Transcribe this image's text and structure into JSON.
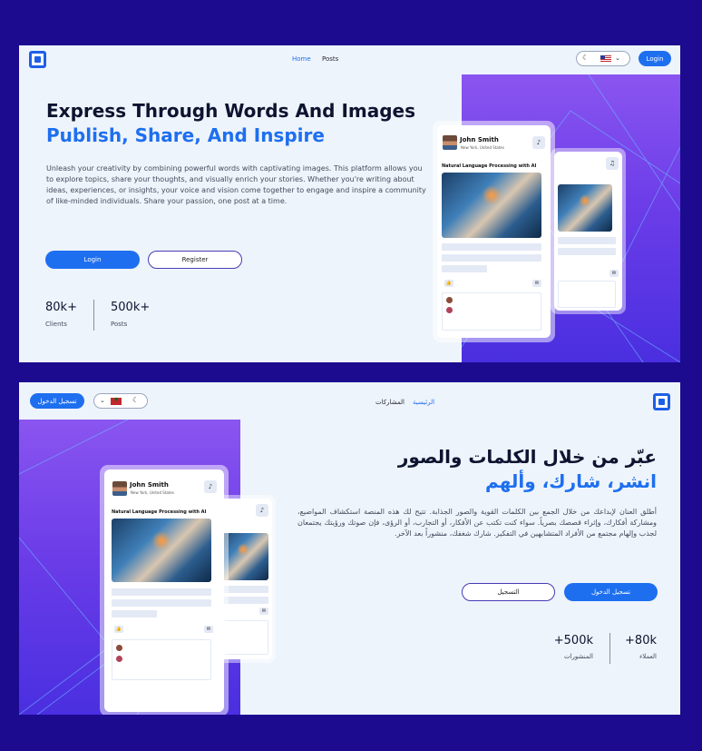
{
  "english": {
    "nav": {
      "home": "Home",
      "posts": "Posts"
    },
    "login_button": "Login",
    "headline": "Express Through Words And Images",
    "subheadline": "Publish, Share, And Inspire",
    "description": "Unleash your creativity by combining powerful words with captivating images. This platform allows you to explore topics, share your thoughts, and visually enrich your stories. Whether you're writing about ideas, experiences, or insights, your voice and vision come together to engage and inspire a community of like-minded individuals. Share your passion, one post at a time.",
    "cta": {
      "login": "Login",
      "register": "Register"
    },
    "stats": [
      {
        "value": "80k+",
        "label": "Clients"
      },
      {
        "value": "500k+",
        "label": "Posts"
      }
    ]
  },
  "arabic": {
    "nav": {
      "home": "الرئيسية",
      "posts": "المشاركات"
    },
    "login_button": "تسجيل الدخول",
    "headline": "عبّر من خلال الكلمات والصور",
    "subheadline": "انشر، شارك، وألهم",
    "description": "أطلق العنان لإبداعك من خلال الجمع بين الكلمات القوية والصور الجذابة. تتيح لك هذه المنصة استكشاف المواضيع، ومشاركة أفكارك، وإثراء قصصك بصرياً. سواء كنت تكتب عن الأفكار، أو التجارب، أو الرؤى، فإن صوتك ورؤيتك يجتمعان لجذب وإلهام مجتمع من الأفراد المتشابهين في التفكير. شارك شغفك، منشوراً بعد الآخر.",
    "cta": {
      "login": "تسجيل الدخول",
      "register": "التسجيل"
    },
    "stats": [
      {
        "value": "80k+",
        "label": "العملاء"
      },
      {
        "value": "500k+",
        "label": "المنشورات"
      }
    ]
  },
  "post_card": {
    "author": "John Smith",
    "location": "New York, United States",
    "title": "Natural Language Processing with AI"
  },
  "colors": {
    "background": "#1c0b8f",
    "accent": "#1e6ff0",
    "gradient_top": "#8a55f0",
    "gradient_bottom": "#4a2fe0"
  },
  "icons": [
    "logo-icon",
    "moon-icon",
    "flag-icon",
    "chevron-down-icon",
    "bell-icon",
    "like-icon",
    "comment-icon"
  ]
}
